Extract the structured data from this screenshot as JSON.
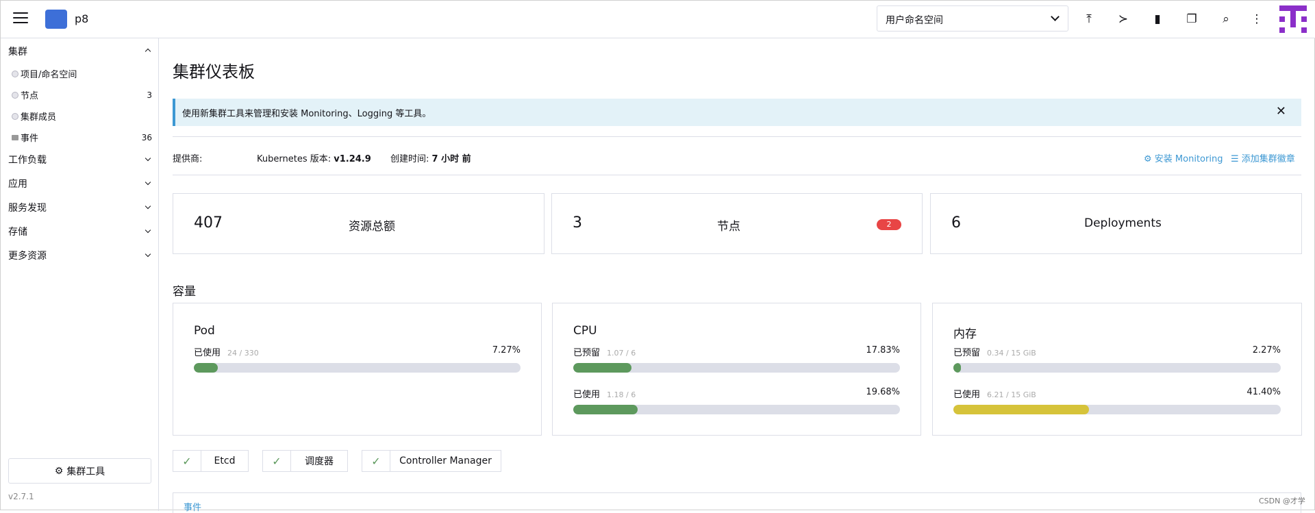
{
  "header": {
    "cluster_name": "p8",
    "namespace_select": "用户命名空间"
  },
  "sidebar": {
    "groups": {
      "cluster": "集群",
      "workloads": "工作负载",
      "apps": "应用",
      "service_discovery": "服务发现",
      "storage": "存储",
      "more": "更多资源"
    },
    "items": [
      {
        "label": "项目/命名空间",
        "count": ""
      },
      {
        "label": "节点",
        "count": "3"
      },
      {
        "label": "集群成员",
        "count": ""
      },
      {
        "label": "事件",
        "count": "36"
      }
    ],
    "tools_button": "集群工具",
    "version": "v2.7.1"
  },
  "main": {
    "title": "集群仪表板",
    "banner": "使用新集群工具来管理和安装 Monitoring、Logging 等工具。",
    "meta": {
      "provider_label": "提供商:",
      "k8s_label": "Kubernetes 版本:",
      "k8s_value": "v1.24.9",
      "created_label": "创建时间:",
      "created_value": "7 小时 前"
    },
    "links": {
      "install_monitoring": "安装 Monitoring",
      "add_badge": "添加集群徽章"
    },
    "cards": [
      {
        "num": "407",
        "label": "资源总额"
      },
      {
        "num": "3",
        "label": "节点",
        "badge": "2"
      },
      {
        "num": "6",
        "label": "Deployments"
      }
    ],
    "capacity_title": "容量",
    "capacity": {
      "pod": {
        "title": "Pod",
        "used_label": "已使用",
        "used_sub": "24 / 330",
        "used_pct": "7.27%",
        "used_fill": 7.27
      },
      "cpu": {
        "title": "CPU",
        "reserved_label": "已预留",
        "reserved_sub": "1.07 / 6",
        "reserved_pct": "17.83%",
        "reserved_fill": 17.83,
        "used_label": "已使用",
        "used_sub": "1.18 / 6",
        "used_pct": "19.68%",
        "used_fill": 19.68
      },
      "mem": {
        "title": "内存",
        "reserved_label": "已预留",
        "reserved_sub": "0.34 / 15 GiB",
        "reserved_pct": "2.27%",
        "reserved_fill": 2.27,
        "used_label": "已使用",
        "used_sub": "6.21 / 15 GiB",
        "used_pct": "41.40%",
        "used_fill": 41.4
      }
    },
    "components": [
      "Etcd",
      "调度器",
      "Controller Manager"
    ],
    "events_tab": "事件",
    "watermark": "CSDN @才学"
  },
  "colors": {
    "green_fill": "#5d995d",
    "yellow_fill": "#d6c33a",
    "accent": "#3d98d3",
    "badge_red": "#e84545"
  },
  "icons": [
    "hamburger-icon",
    "upload-icon",
    "terminal-icon",
    "file-icon",
    "copy-icon",
    "search-icon",
    "more-icon",
    "gear-icon",
    "list-icon",
    "check-icon",
    "close-icon"
  ]
}
